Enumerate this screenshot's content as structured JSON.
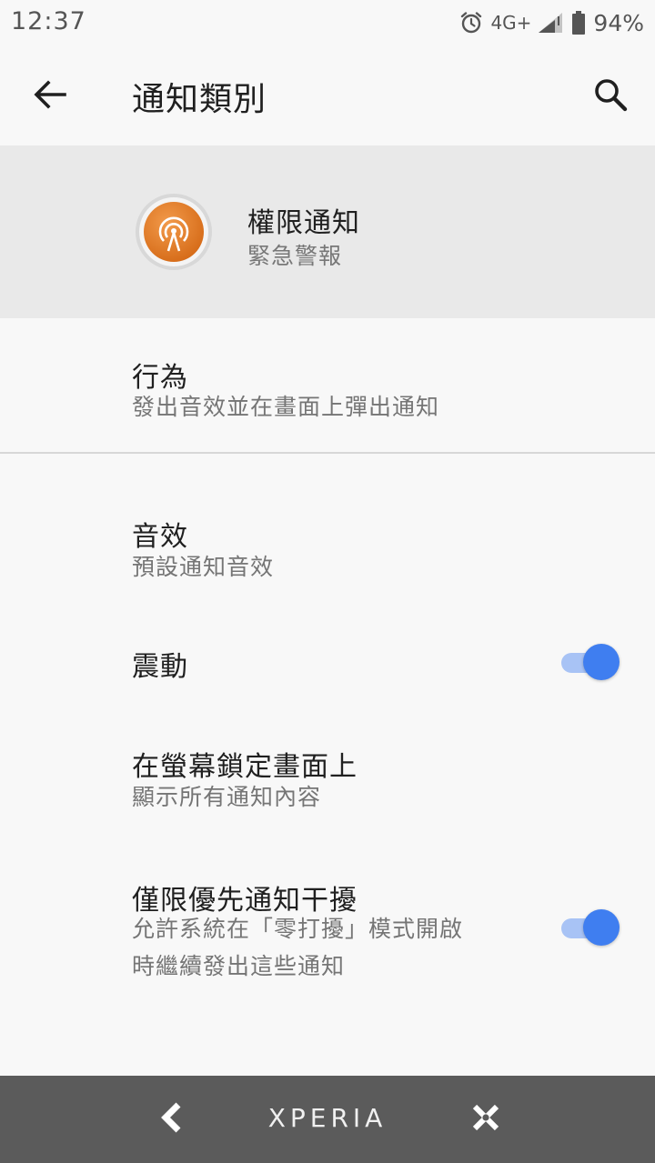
{
  "status_bar": {
    "time": "12:37",
    "network": "4G+",
    "battery": "94%",
    "icons": [
      "alarm-icon",
      "signal-icon",
      "battery-icon"
    ]
  },
  "app_bar": {
    "title": "通知類別",
    "icons": [
      "back-arrow-icon",
      "search-icon"
    ]
  },
  "app_header": {
    "name": "權限通知",
    "subtitle": "緊急警報",
    "icon": "broadcast-antenna-icon",
    "icon_color": "#e27a23"
  },
  "settings": {
    "behavior": {
      "title": "行為",
      "subtitle": "發出音效並在畫面上彈出通知"
    },
    "sound": {
      "title": "音效",
      "subtitle": "預設通知音效"
    },
    "vibration": {
      "title": "震動",
      "enabled": true
    },
    "lock_screen": {
      "title": "在螢幕鎖定畫面上",
      "subtitle": "顯示所有通知內容"
    },
    "override_dnd": {
      "title": "僅限優先通知干擾",
      "subtitle_line1": "允許系統在「零打擾」模式開啟",
      "subtitle_line2": "時繼續發出這些通知",
      "enabled": true
    }
  },
  "toggle_colors": {
    "thumb": "#3f7ef0",
    "track": "#a8c3f5"
  },
  "nav_bar": {
    "brand": "XPERIA",
    "icons": [
      "nav-back-icon",
      "nav-close-icon"
    ]
  }
}
